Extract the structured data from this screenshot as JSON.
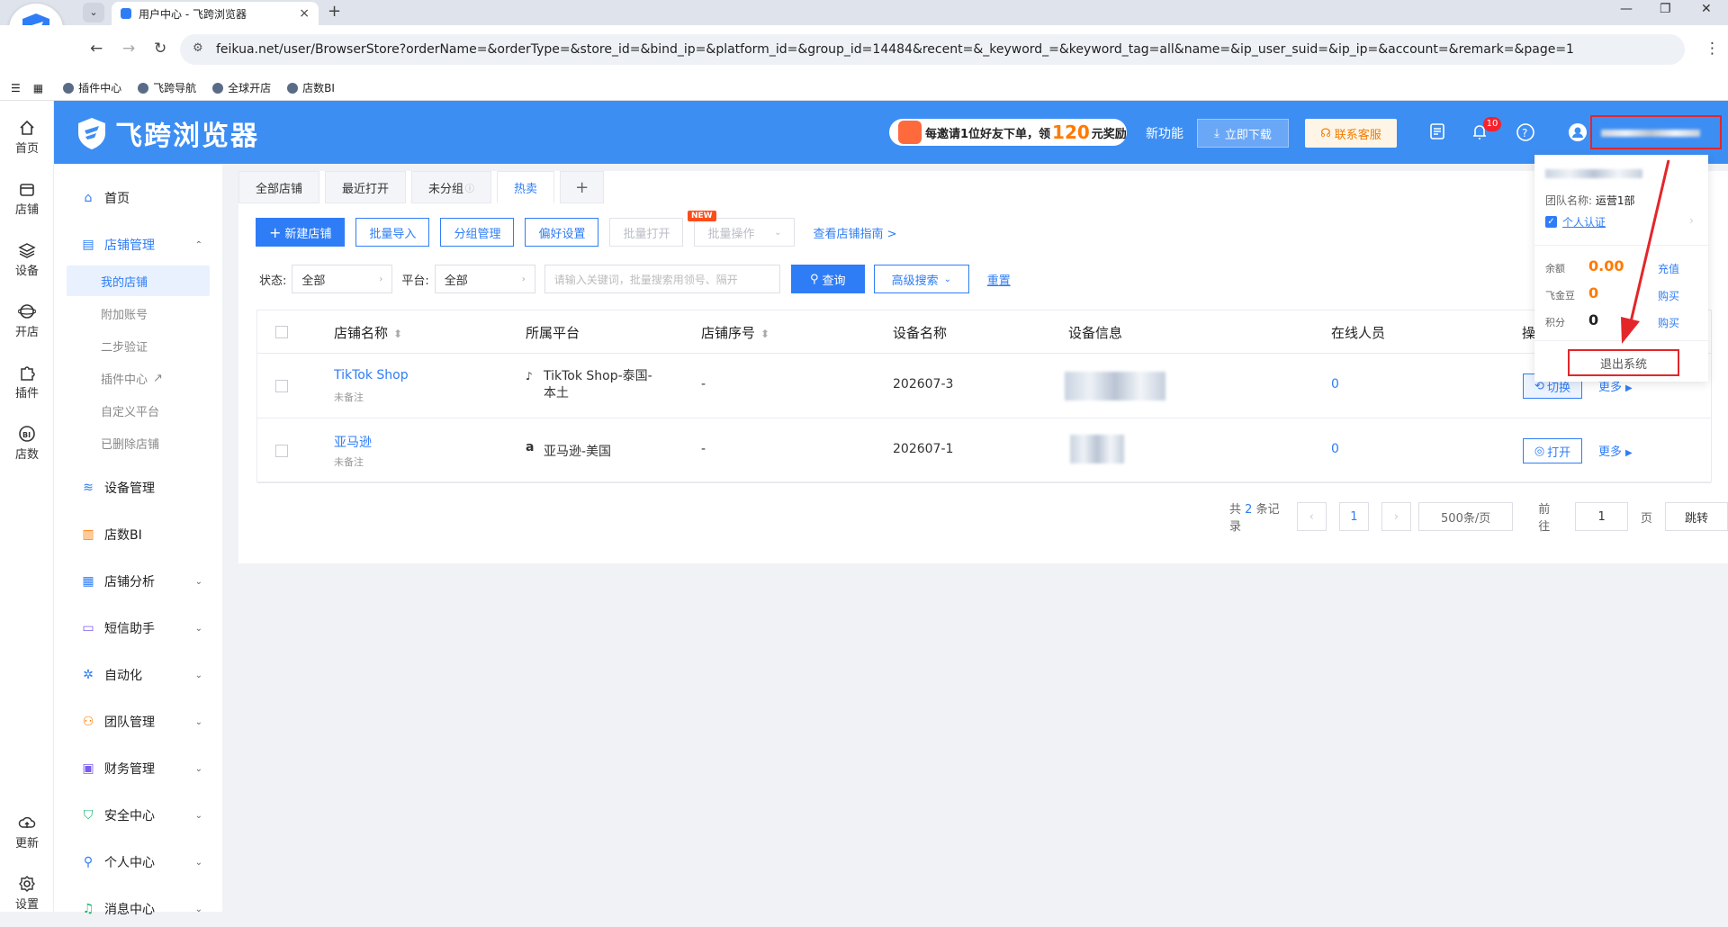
{
  "browser": {
    "tab_title": "用户中心 - 飞跨浏览器",
    "url": "feikua.net/user/BrowserStore?orderName=&orderType=&store_id=&bind_ip=&platform_id=&group_id=14484&recent=&_keyword_=&keyword_tag=all&name=&ip_user_suid=&ip_ip=&account=&remark=&page=1",
    "bookmarks": [
      "插件中心",
      "飞跨导航",
      "全球开店",
      "店数BI"
    ]
  },
  "leftbar": {
    "items": [
      {
        "label": "首页",
        "icon": "home-icon"
      },
      {
        "label": "店铺",
        "icon": "shop-icon"
      },
      {
        "label": "设备",
        "icon": "layers-icon"
      },
      {
        "label": "开店",
        "icon": "globe-icon"
      },
      {
        "label": "插件",
        "icon": "puzzle-icon"
      },
      {
        "label": "店数",
        "icon": "bi-icon"
      }
    ],
    "bottom": [
      {
        "label": "更新",
        "icon": "cloud-upload-icon"
      },
      {
        "label": "设置",
        "icon": "gear-icon"
      }
    ]
  },
  "header": {
    "brand": "飞跨浏览器",
    "promo_prefix": "每邀请1位好友下单，领",
    "promo_amount": "120",
    "promo_suffix": "元奖励",
    "new_feature": "新功能",
    "download": "立即下载",
    "support": "联系客服",
    "notifications": "10"
  },
  "sidebar": {
    "home": "首页",
    "store_mgmt": "店铺管理",
    "sub": [
      "我的店铺",
      "附加账号",
      "二步验证",
      "插件中心",
      "自定义平台",
      "已删除店铺"
    ],
    "items": [
      "设备管理",
      "店数BI",
      "店铺分析",
      "短信助手",
      "自动化",
      "团队管理",
      "财务管理",
      "安全中心",
      "个人中心",
      "消息中心"
    ]
  },
  "tabs": [
    "全部店铺",
    "最近打开",
    "未分组",
    "热卖",
    "+"
  ],
  "toolbar": {
    "new_store": "新建店铺",
    "batch_import": "批量导入",
    "group_mgmt": "分组管理",
    "preferences": "偏好设置",
    "batch_open": "批量打开",
    "batch_ops": "批量操作",
    "new_badge": "NEW",
    "guide": "查看店铺指南 >"
  },
  "filters": {
    "status_label": "状态:",
    "status_value": "全部",
    "platform_label": "平台:",
    "platform_value": "全部",
    "keyword_placeholder": "请输入关键词，批量搜索用领号、隔开",
    "query": "查询",
    "advanced": "高级搜索",
    "reset": "重置"
  },
  "table": {
    "columns": [
      "店铺名称",
      "所属平台",
      "店铺序号",
      "设备名称",
      "设备信息",
      "在线人员",
      "操作"
    ],
    "rows": [
      {
        "name": "TikTok Shop",
        "note": "未备注",
        "platform_line1": "TikTok Shop-泰国-",
        "platform_line2": "本土",
        "seq": "-",
        "device": "202607-3",
        "online": "0",
        "action": "切换",
        "more": "更多"
      },
      {
        "name": "亚马逊",
        "note": "未备注",
        "platform_line1": "亚马逊-美国",
        "platform_line2": "",
        "seq": "-",
        "device": "202607-1",
        "online": "0",
        "action": "打开",
        "more": "更多"
      }
    ]
  },
  "pager": {
    "total_prefix": "共",
    "total": "2",
    "total_suffix": "条记录",
    "page": "1",
    "per_page": "500条/页",
    "goto": "前往",
    "goto_page": "1",
    "page_unit": "页",
    "jump": "跳转"
  },
  "popup": {
    "team_label": "团队名称:",
    "team": "运营1部",
    "verify": "个人认证",
    "balance_label": "余额",
    "balance": "0.00",
    "recharge": "充值",
    "beans_label": "飞金豆",
    "beans": "0",
    "buy1": "购买",
    "points_label": "积分",
    "points": "0",
    "buy2": "购买",
    "logout": "退出系统"
  },
  "colors": {
    "primary": "#2f7df6",
    "header": "#3d8ef3",
    "highlight": "#e3262a",
    "orange": "#ff7a00"
  }
}
